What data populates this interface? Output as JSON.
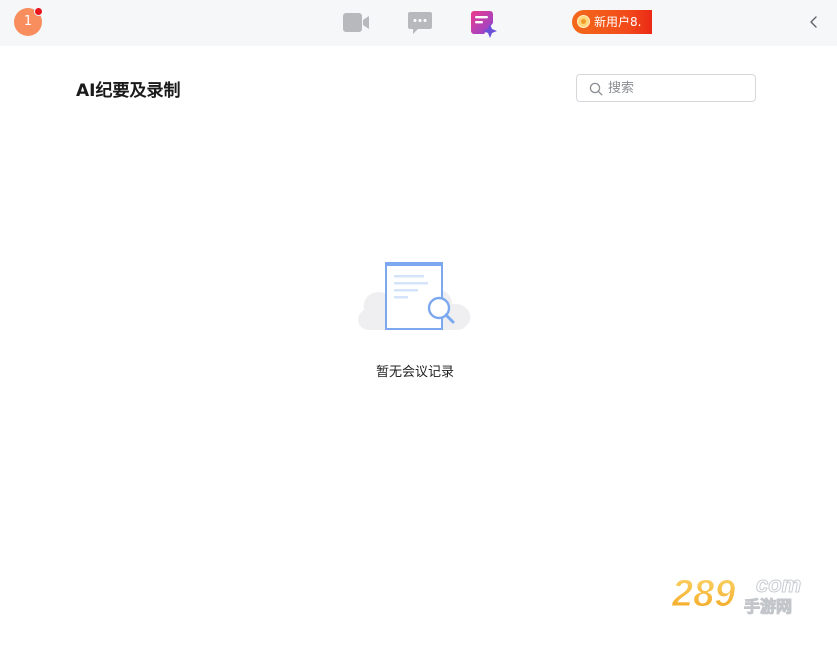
{
  "header": {
    "avatar_text": "1",
    "promo_text": "新用户8."
  },
  "main": {
    "title": "AI纪要及录制",
    "search": {
      "placeholder": "搜索",
      "value": ""
    },
    "empty_state": {
      "message": "暂无会议记录"
    }
  },
  "watermark": {
    "number": "289",
    "suffix": "com",
    "subtitle": "手游网"
  },
  "colors": {
    "avatar": "#f88d5e",
    "promo_start": "#f36a1b",
    "promo_end": "#ea2a16",
    "ai_icon": "#d43bbf",
    "nav_icon_gray": "#b8b9bd"
  },
  "icons": {
    "nav": [
      "video-camera-icon",
      "chat-bubble-icon",
      "ai-minutes-icon"
    ],
    "search": "search-icon",
    "collapse": "chevron-left-icon",
    "empty": "empty-document-icon"
  }
}
